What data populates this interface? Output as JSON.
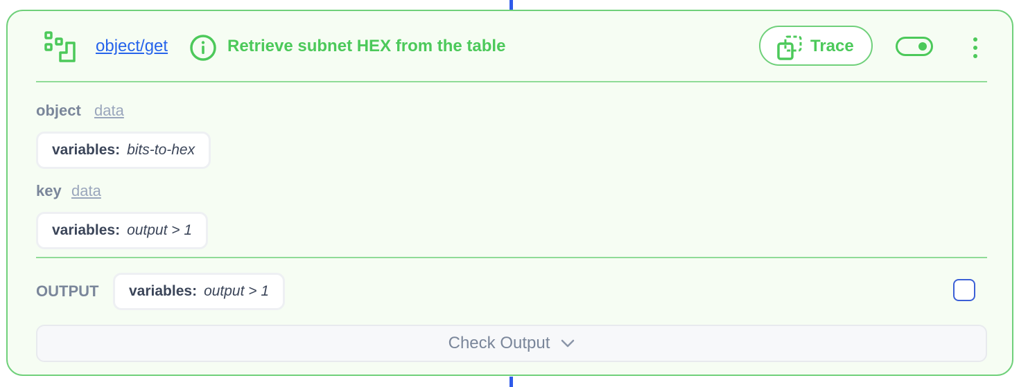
{
  "step": {
    "link_label": "object/get",
    "description": "Retrieve subnet HEX from the table",
    "trace_label": "Trace",
    "toggle_enabled": true
  },
  "params": [
    {
      "label": "object",
      "type": "data",
      "chip_key": "variables:",
      "chip_value": "bits-to-hex"
    },
    {
      "label": "key",
      "type": "data",
      "chip_key": "variables:",
      "chip_value": "output > 1"
    }
  ],
  "output": {
    "label": "OUTPUT",
    "chip_key": "variables:",
    "chip_value": "output > 1",
    "checked": false
  },
  "check_output": {
    "label": "Check Output"
  },
  "icons": {
    "step": "step-icon",
    "info": "info-icon",
    "trace": "trace-icon",
    "menu": "kebab-menu-icon",
    "expand": "chevron-down-icon"
  },
  "colors": {
    "accent_green": "#4cc95a",
    "border_green": "#6fd07a",
    "link_blue": "#2563eb",
    "connector_blue": "#2f5bea",
    "card_bg": "#f6fdf3"
  }
}
